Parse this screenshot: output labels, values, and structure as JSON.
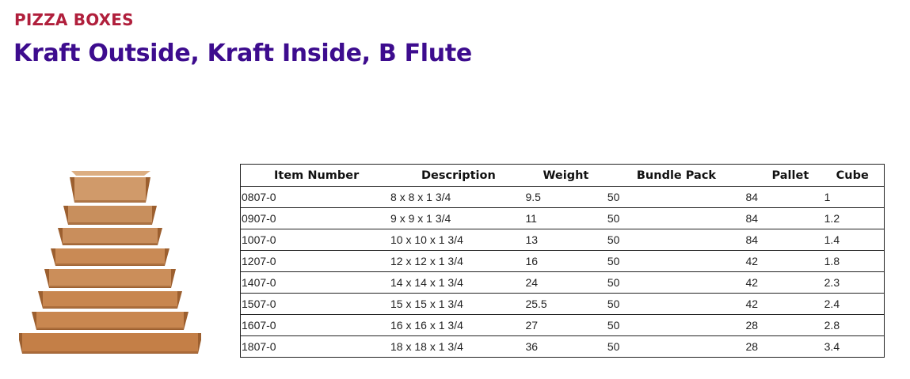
{
  "header": {
    "eyebrow": "PIZZA BOXES",
    "title": "Kraft Outside, Kraft Inside, B Flute"
  },
  "image": {
    "description_icon": "stacked-pizza-boxes-image",
    "box_color": "#c98a55"
  },
  "table": {
    "columns": [
      "Item Number",
      "Description",
      "Weight",
      "Bundle Pack",
      "Pallet",
      "Cube"
    ],
    "rows": [
      [
        "0807-0",
        "8 x 8 x 1 3/4",
        "9.5",
        "50",
        "84",
        "1"
      ],
      [
        "0907-0",
        "9 x 9 x 1 3/4",
        "11",
        "50",
        "84",
        "1.2"
      ],
      [
        "1007-0",
        "10 x 10 x 1 3/4",
        "13",
        "50",
        "84",
        "1.4"
      ],
      [
        "1207-0",
        "12 x 12 x 1 3/4",
        "16",
        "50",
        "42",
        "1.8"
      ],
      [
        "1407-0",
        "14 x 14 x 1 3/4",
        "24",
        "50",
        "42",
        "2.3"
      ],
      [
        "1507-0",
        "15 x 15 x 1 3/4",
        "25.5",
        "50",
        "42",
        "2.4"
      ],
      [
        "1607-0",
        "16 x 16 x 1 3/4",
        "27",
        "50",
        "28",
        "2.8"
      ],
      [
        "1807-0",
        "18 x 18 x 1 3/4",
        "36",
        "50",
        "28",
        "3.4"
      ]
    ]
  },
  "colors": {
    "eyebrow": "#b01f3c",
    "title": "#3d0c8e"
  }
}
